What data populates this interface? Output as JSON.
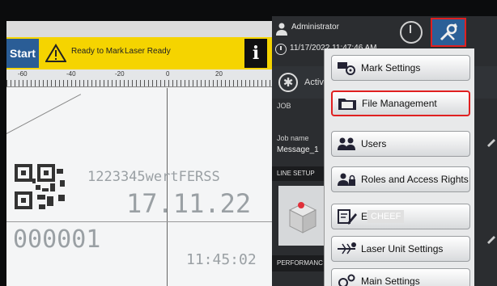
{
  "toolbar": {
    "start_label": "Start",
    "status_ready_to_mark": "Ready to Mark",
    "status_laser_ready": "Laser Ready",
    "info_label": "i"
  },
  "ruler": {
    "labels": [
      "-60",
      "-40",
      "-20",
      "0",
      "20"
    ]
  },
  "canvas": {
    "line1": "1223345wertFERSS",
    "line2": "17.11.22",
    "line3": "000001",
    "line4": "11:45:02"
  },
  "header": {
    "user": "Administrator",
    "datetime": "11/17/2022 11:47:46 AM"
  },
  "side": {
    "active_label": "Active",
    "job_label": "JOB",
    "job_name_label": "Job name",
    "job_name_value": "Message_1",
    "line_setup_label": "LINE SETUP",
    "performance_label": "PERFORMANC"
  },
  "menu": {
    "items": [
      {
        "label": "Mark Settings",
        "icon": "mark-settings-icon"
      },
      {
        "label": "File Management",
        "icon": "folder-icon"
      },
      {
        "label": "Users",
        "icon": "users-icon"
      },
      {
        "label": "Roles and Access Rights",
        "icon": "user-lock-icon"
      },
      {
        "label": "E",
        "icon": "editor-icon"
      },
      {
        "label": "Laser Unit Settings",
        "icon": "laser-icon"
      },
      {
        "label": "Main Settings",
        "icon": "main-settings-icon"
      }
    ],
    "watermark_chip": "CHEEF"
  },
  "colors": {
    "status_yellow": "#f5d400",
    "start_blue": "#2a5d96",
    "highlight_red": "#e02020",
    "panel_dark": "#2b2d30"
  }
}
